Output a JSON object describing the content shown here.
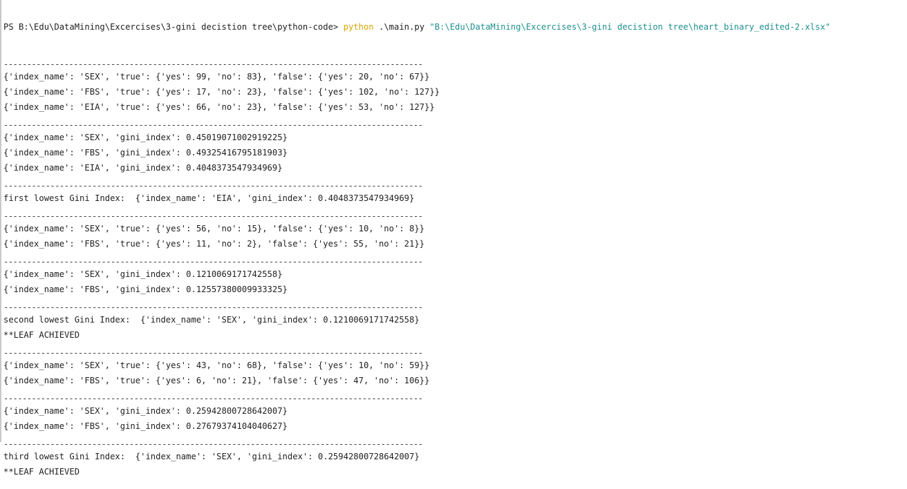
{
  "terminal": {
    "prompt": "PS B:\\Edu\\DataMining\\Excercises\\3-gini decistion tree\\python-code> ",
    "command": "python",
    "script": " .\\main.py ",
    "argument": "\"B:\\Edu\\DataMining\\Excercises\\3-gini decistion tree\\heart_binary_edited-2.xlsx\"",
    "separator": "------------------------------------------------------------------------------------------",
    "output": [
      {
        "type": "sep"
      },
      {
        "type": "text",
        "text": "{'index_name': 'SEX', 'true': {'yes': 99, 'no': 83}, 'false': {'yes': 20, 'no': 67}}"
      },
      {
        "type": "text",
        "text": "{'index_name': 'FBS', 'true': {'yes': 17, 'no': 23}, 'false': {'yes': 102, 'no': 127}}"
      },
      {
        "type": "text",
        "text": "{'index_name': 'EIA', 'true': {'yes': 66, 'no': 23}, 'false': {'yes': 53, 'no': 127}}"
      },
      {
        "type": "sep"
      },
      {
        "type": "text",
        "text": "{'index_name': 'SEX', 'gini_index': 0.45019071002919225}"
      },
      {
        "type": "text",
        "text": "{'index_name': 'FBS', 'gini_index': 0.49325416795181903}"
      },
      {
        "type": "text",
        "text": "{'index_name': 'EIA', 'gini_index': 0.4048373547934969}"
      },
      {
        "type": "sep"
      },
      {
        "type": "text",
        "text": "first lowest Gini Index:  {'index_name': 'EIA', 'gini_index': 0.4048373547934969}"
      },
      {
        "type": "sep"
      },
      {
        "type": "text",
        "text": "{'index_name': 'SEX', 'true': {'yes': 56, 'no': 15}, 'false': {'yes': 10, 'no': 8}}"
      },
      {
        "type": "text",
        "text": "{'index_name': 'FBS', 'true': {'yes': 11, 'no': 2}, 'false': {'yes': 55, 'no': 21}}"
      },
      {
        "type": "sep"
      },
      {
        "type": "text",
        "text": "{'index_name': 'SEX', 'gini_index': 0.1210069171742558}"
      },
      {
        "type": "text",
        "text": "{'index_name': 'FBS', 'gini_index': 0.12557380009933325}"
      },
      {
        "type": "sep"
      },
      {
        "type": "text",
        "text": "second lowest Gini Index:  {'index_name': 'SEX', 'gini_index': 0.1210069171742558}"
      },
      {
        "type": "text",
        "text": "**LEAF ACHIEVED"
      },
      {
        "type": "sep"
      },
      {
        "type": "text",
        "text": "{'index_name': 'SEX', 'true': {'yes': 43, 'no': 68}, 'false': {'yes': 10, 'no': 59}}"
      },
      {
        "type": "text",
        "text": "{'index_name': 'FBS', 'true': {'yes': 6, 'no': 21}, 'false': {'yes': 47, 'no': 106}}"
      },
      {
        "type": "sep"
      },
      {
        "type": "text",
        "text": "{'index_name': 'SEX', 'gini_index': 0.25942800728642007}"
      },
      {
        "type": "text",
        "text": "{'index_name': 'FBS', 'gini_index': 0.27679374104040627}"
      },
      {
        "type": "sep"
      },
      {
        "type": "text",
        "text": "third lowest Gini Index:  {'index_name': 'SEX', 'gini_index': 0.25942800728642007}"
      },
      {
        "type": "text",
        "text": "**LEAF ACHIEVED"
      }
    ]
  },
  "colors": {
    "background": "#ffffff",
    "text": "#1e1e1e",
    "command": "#d9a400",
    "argument": "#1f8f8f"
  }
}
